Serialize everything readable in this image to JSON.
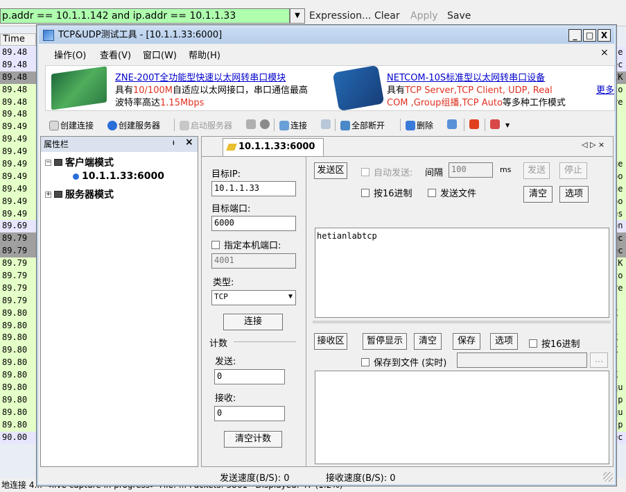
{
  "background": {
    "filter_text": "p.addr == 10.1.1.142 and ip.addr == 10.1.1.33",
    "toolbar": [
      "Expression...",
      "Clear",
      "Apply",
      "Save"
    ],
    "time_header": "Time",
    "time_rows": [
      "89.48",
      "89.48",
      "89.48",
      "89.48",
      "89.48",
      "89.48",
      "89.49",
      "89.49",
      "89.49",
      "89.49",
      "89.49",
      "89.49",
      "89.49",
      "89.49",
      "89.69",
      "89.79",
      "89.79",
      "89.79",
      "89.79",
      "89.79",
      "89.79",
      "89.80",
      "89.80",
      "89.80",
      "89.80",
      "89.80",
      "89.80",
      "89.80",
      "89.80",
      "89.80",
      "89.80",
      "90.00"
    ],
    "right_rows": [
      "se",
      "ec",
      "CK",
      "co",
      "re",
      "",
      "",
      "",
      "",
      "ue",
      "po",
      "ue",
      "po",
      "es",
      "on",
      "ec",
      "ec",
      "CK",
      "co",
      "re",
      "",
      "K",
      "",
      "K",
      "K",
      "",
      "K",
      "qu",
      "sp",
      "qu",
      "sp",
      "ec"
    ],
    "status": "地连接 4...  <live capture in progress>  File: ...  Packets: 3861 · Displayed: 47 (1.2%)"
  },
  "window": {
    "title": "TCP&UDP测试工具 - [10.1.1.33:6000]",
    "controls": {
      "minimize": "_",
      "maximize": "□",
      "close": "X"
    }
  },
  "menu": {
    "items": [
      "操作(O)",
      "查看(V)",
      "窗口(W)",
      "帮助(H)"
    ],
    "close": "×"
  },
  "banner": {
    "ad1": {
      "link": "ZNE-200T全功能型快速以太网转串口模块",
      "line2_a": "具有",
      "line2_red": "10/100M",
      "line2_b": "自适应以太网接口，串口通信最高",
      "line3_a": "波特率高达",
      "line3_red": "1.15Mbps"
    },
    "ad2": {
      "link": "NETCOM-10S标准型以太网转串口设备",
      "line2_a": "具有",
      "line2_red": "TCP Server,TCP Client, UDP, Real",
      "line3_red": "COM ,Group组播,TCP Auto",
      "line3_b": "等多种工作模式"
    },
    "more": "更多"
  },
  "toolbar": {
    "create_conn": "创建连接",
    "create_server": "创建服务器",
    "start_server": "启动服务器",
    "connect": "连接",
    "disconnect_all": "全部断开",
    "delete": "删除"
  },
  "property_panel": {
    "title": "属性栏",
    "pin": "ᵼ",
    "close": "×",
    "client_mode": "客户端模式",
    "client_entry": "10.1.1.33:6000",
    "server_mode": "服务器模式"
  },
  "doc": {
    "tab_label": "10.1.1.33:6000",
    "nav": "◁ ▷ ×",
    "target_ip_label": "目标IP:",
    "target_ip": "10.1.1.33",
    "target_port_label": "目标端口:",
    "target_port": "6000",
    "local_port_label": "指定本机端口:",
    "local_port": "4001",
    "type_label": "类型:",
    "type_value": "TCP",
    "connect_button": "连接",
    "count_label": "计数",
    "send_label": "发送:",
    "send_count": "0",
    "recv_label": "接收:",
    "recv_count": "0",
    "clear_count_button": "清空计数",
    "send_zone_button": "发送区",
    "auto_send_label": "自动发送:",
    "interval_label": "间隔",
    "interval_value": "100",
    "ms": "ms",
    "send_button": "发送",
    "stop_button": "停止",
    "hex_send_label": "按16进制",
    "send_file_label": "发送文件",
    "clear_button": "清空",
    "options_button": "选项",
    "send_text": "hetianlabtcp",
    "recv_zone_button": "接收区",
    "pause_display_button": "暂停显示",
    "recv_clear_button": "清空",
    "save_button": "保存",
    "recv_options_button": "选项",
    "recv_hex_label": "按16进制",
    "save_to_file_label": "保存到文件 (实时)",
    "browse_button": "..."
  },
  "statusbar": {
    "send_speed": "发送速度(B/S): 0",
    "recv_speed": "接收速度(B/S): 0"
  }
}
